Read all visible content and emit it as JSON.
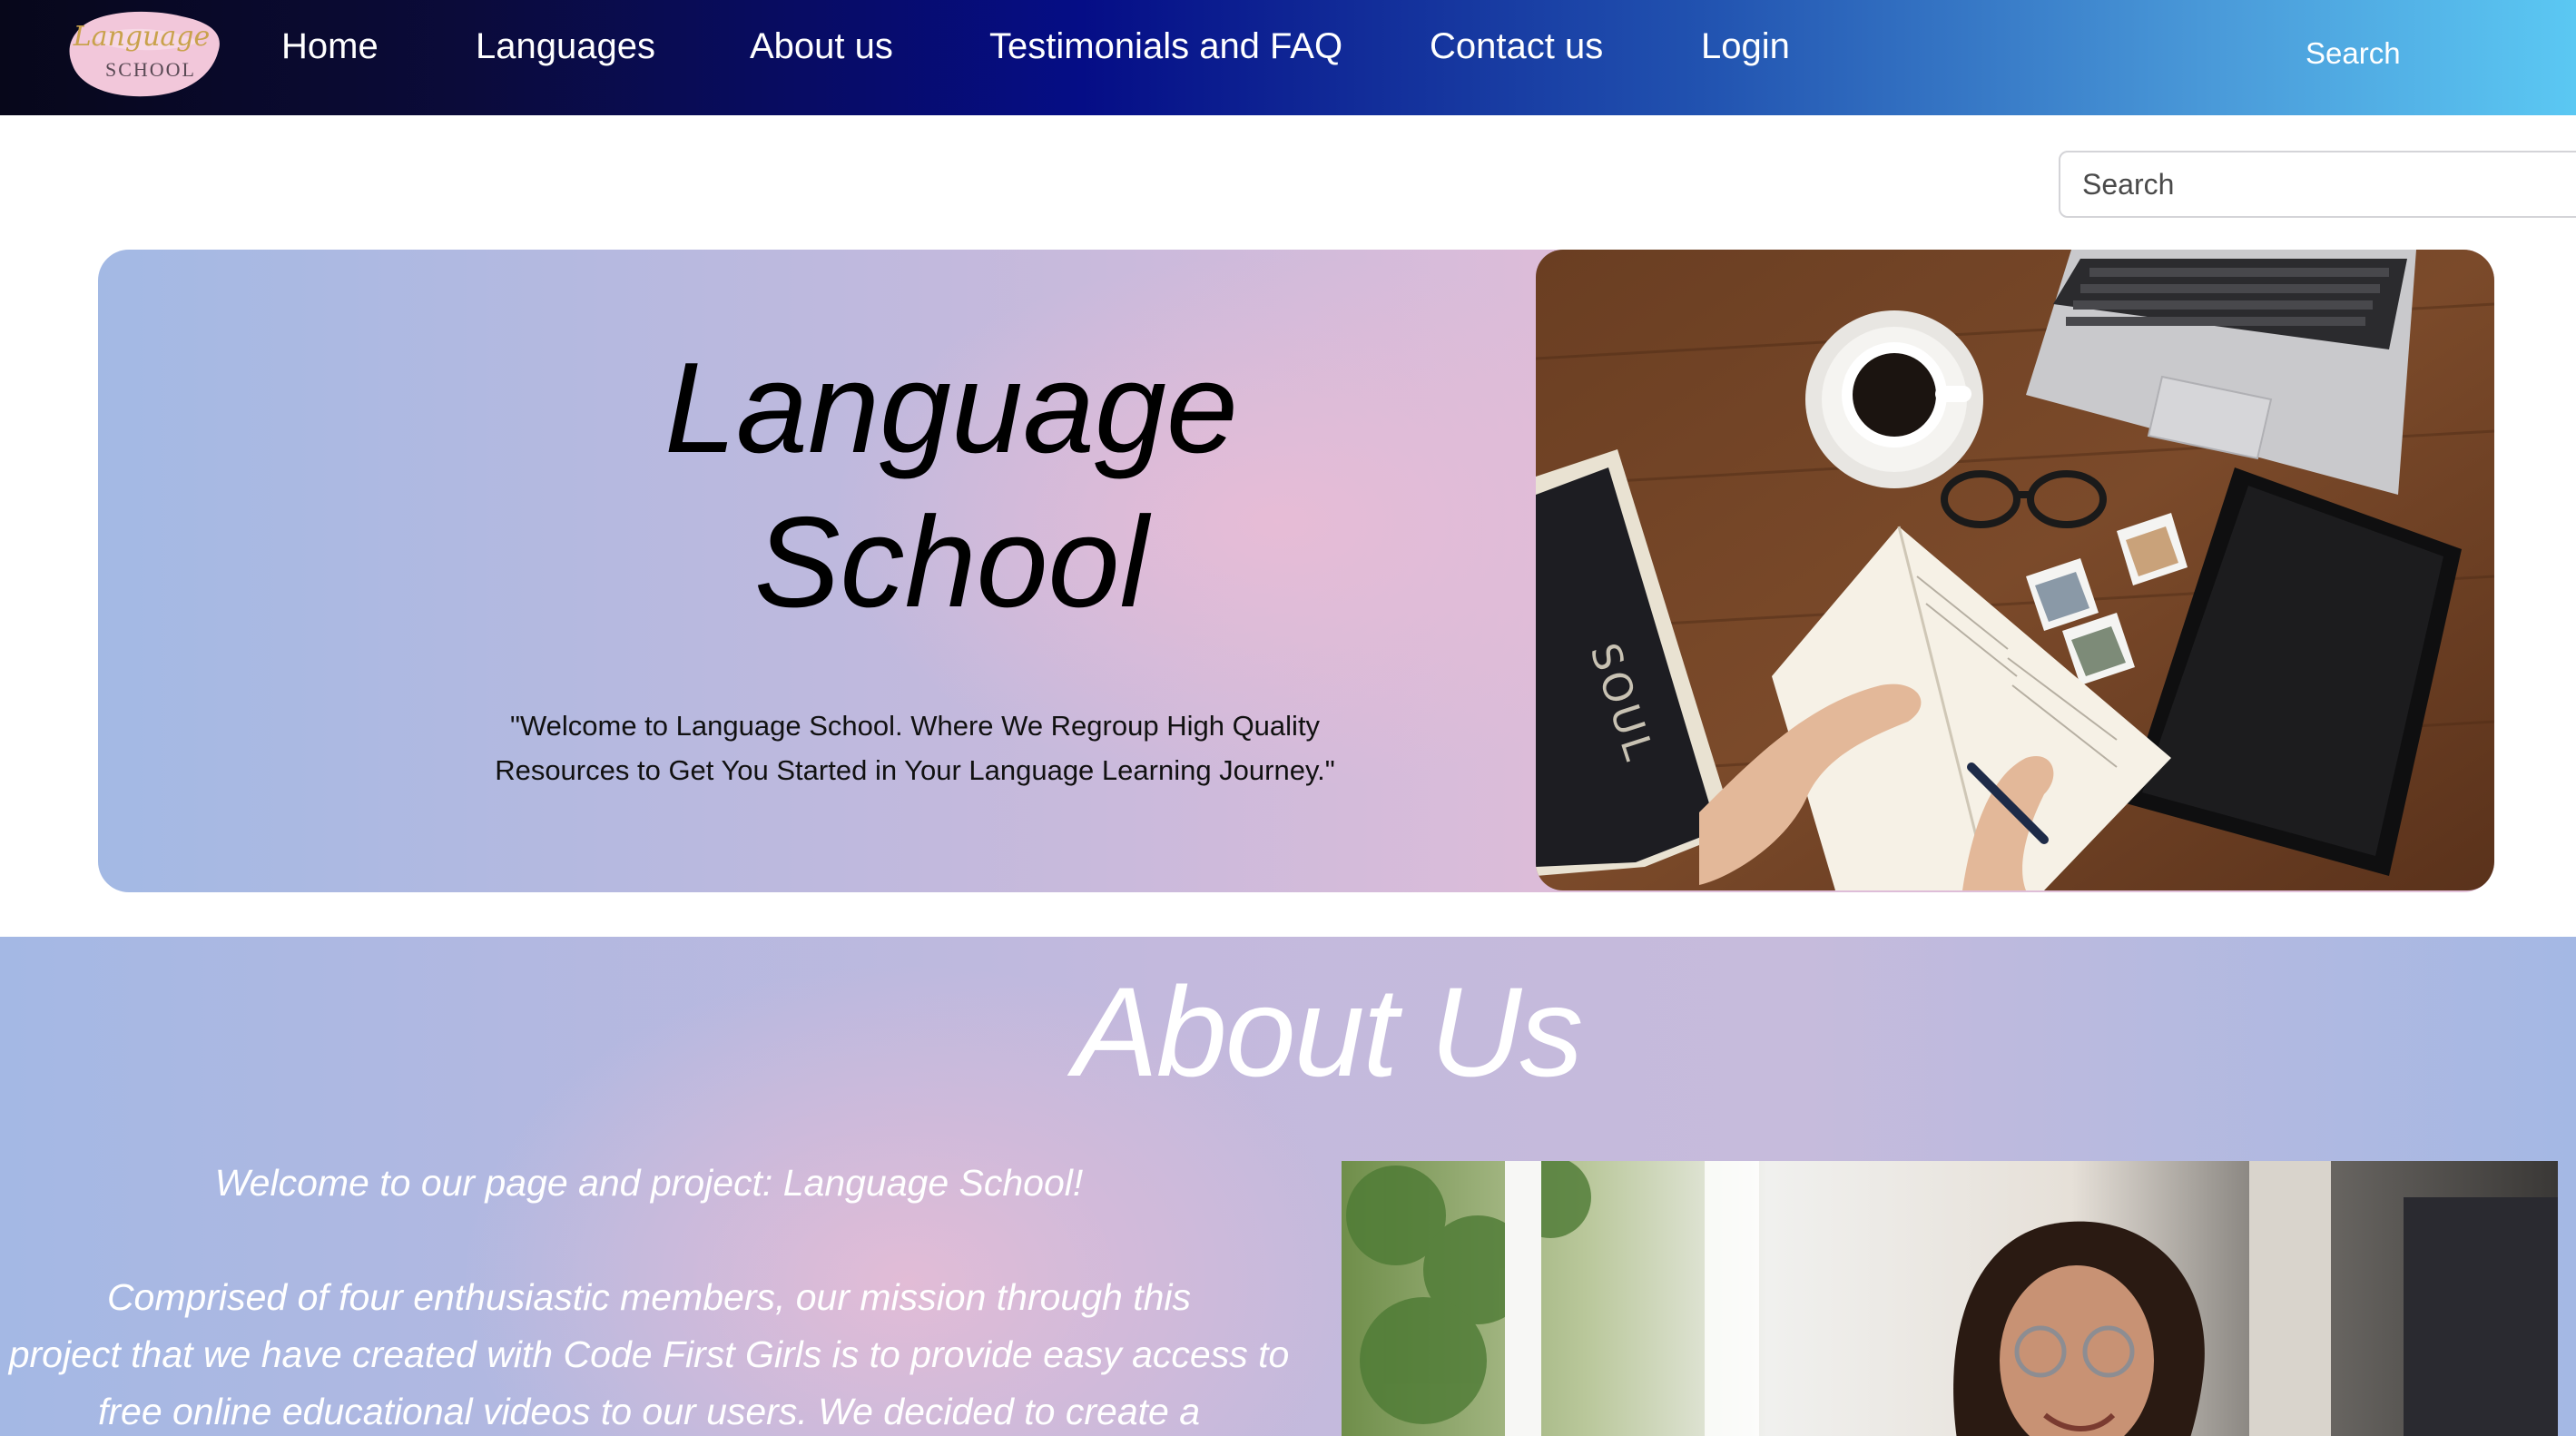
{
  "navbar": {
    "logo_alt": "Language School logo",
    "logo_text_script": "Language",
    "logo_text_caps": "SCHOOL",
    "links": [
      "Home",
      "Languages",
      "About us",
      "Testimonials and FAQ",
      "Contact us",
      "Login"
    ],
    "search_label": "Search"
  },
  "search": {
    "placeholder": "Search"
  },
  "hero": {
    "title_line1": "Language",
    "title_line2": "School",
    "quote_line1": "\"Welcome to Language School. Where We Regroup High Quality",
    "quote_line2": "Resources to Get You Started in Your Language Learning Journey.\""
  },
  "about": {
    "title": "About Us",
    "intro": "Welcome to our page and project: Language School!",
    "body_line1": "Comprised of four enthusiastic members, our mission through this",
    "body_line2": "project that we have created with Code First Girls is to provide easy access to",
    "body_line3": "free online educational videos to our users. We decided to create a"
  },
  "colors": {
    "nav_start": "#07071a",
    "nav_mid": "#050d86",
    "nav_end": "#5bc8f3",
    "hero_blue": "#a3b9e4",
    "hero_pink": "#e1bfd8"
  }
}
